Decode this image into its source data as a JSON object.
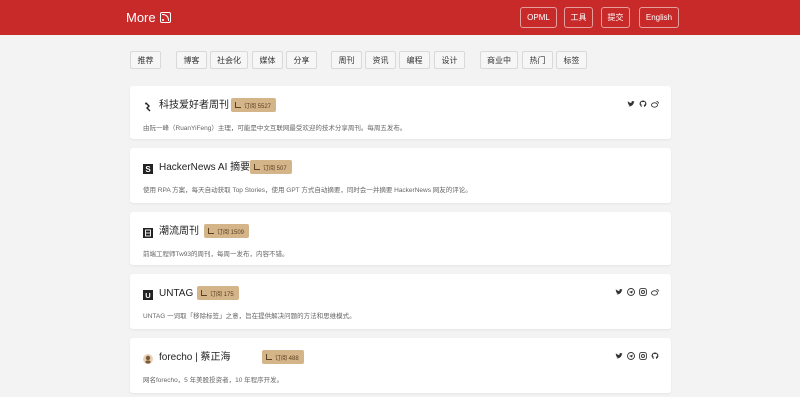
{
  "header": {
    "logo_text": "More",
    "nav": [
      "OPML",
      "工具",
      "提交",
      "English"
    ]
  },
  "filters": [
    "推荐",
    "博客",
    "社会化",
    "媒体",
    "分享",
    "周刊",
    "资讯",
    "编程",
    "设计",
    "商业中",
    "热门",
    "标签"
  ],
  "cards": [
    {
      "title": "科技爱好者周刊",
      "badge": "订阅 5527",
      "desc": "由阮一峰（RuanYiFeng）主理，可能是中文互联网最受欢迎的技术分享周刊。每周五发布。",
      "socials": [
        "twitter-icon",
        "github-icon",
        "weibo-icon"
      ]
    },
    {
      "title": "HackerNews AI 摘要",
      "badge": "订阅 507",
      "desc": "使用 RPA 方案，每天自动获取 Top Stories，使用 GPT 方式自动摘要，同时会一并摘要 HackerNews 网友的评论。",
      "socials": []
    },
    {
      "title": "潮流周刊",
      "badge": "订阅 1509",
      "desc": "前端工程师Tw93的周刊，每周一发布，内容不错。",
      "socials": []
    },
    {
      "title": "UNTAG",
      "badge": "订阅 175",
      "desc": "UNTAG 一词取「移除标签」之意，旨在提供解决问题的方法和思维模式。",
      "socials": [
        "twitter-icon",
        "telegram-icon",
        "instagram-icon",
        "weibo-icon"
      ]
    },
    {
      "title": "forecho | 蔡正海",
      "badge": "订阅 488",
      "desc": "网名forecho，5 年美股投资者，10 年程序开发。",
      "socials": [
        "twitter-icon",
        "telegram-icon",
        "instagram-icon",
        "github-icon"
      ]
    }
  ],
  "colors": {
    "header_red": "#c82a2a",
    "badge_tan": "#d4b58a"
  }
}
